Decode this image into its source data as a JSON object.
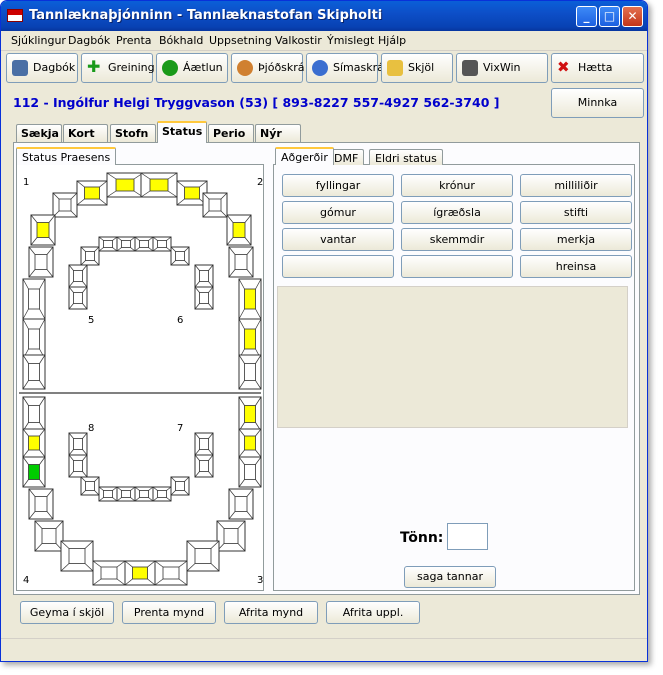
{
  "window": {
    "title": "Tannlæknaþjónninn - Tannlæknastofan Skipholti"
  },
  "menu": [
    "Sjúklingur",
    "Dagbók",
    "Prenta",
    "Bókhald",
    "Uppsetning",
    "Valkostir",
    "Ýmislegt",
    "Hjálp"
  ],
  "toolbar": {
    "dagbok": "Dagbók",
    "greining": "Greining",
    "aaetlun": "Áætlun",
    "thjodskra": "Þjóðskrá",
    "simaskra": "Símaskrá",
    "skjol": "Skjöl",
    "vixwin": "VixWin",
    "haetta": "Hætta"
  },
  "patient": {
    "line": "112 - Ingólfur Helgi Tryggvason (53)  [ 893-8227  557-4927  562-3740 ]"
  },
  "minnka": "Minnka",
  "tabs": [
    "Sækja",
    "Kort",
    "Stofn",
    "Status",
    "Perio",
    "Nýr"
  ],
  "active_tab": "Status",
  "left_tab": "Status Praesens",
  "quadrants": {
    "q1": "1",
    "q2": "2",
    "q3": "3",
    "q4": "4",
    "q5": "5",
    "q6": "6",
    "q7": "7",
    "q8": "8"
  },
  "right_tabs": [
    "Aðgerðir",
    "DMF",
    "Eldri status"
  ],
  "actions": {
    "fyllingar": "fyllingar",
    "kronur": "krónur",
    "millilidir": "milliliðir",
    "gomur": "gómur",
    "igraedsla": "ígræðsla",
    "stifti": "stifti",
    "vantar": "vantar",
    "skemmdir": "skemmdir",
    "merkja": "merkja",
    "hreinsa": "hreinsa"
  },
  "tonn_label": "Tönn:",
  "tonn_value": "",
  "saga_tannar": "saga tannar",
  "bottom": {
    "geyma": "Geyma í skjöl",
    "prenta": "Prenta mynd",
    "afrita_mynd": "Afrita mynd",
    "afrita_uppl": "Afrita uppl."
  },
  "colors": {
    "accent": "#0000cc",
    "filled": "#ffff00",
    "crown": "#00cc00"
  }
}
